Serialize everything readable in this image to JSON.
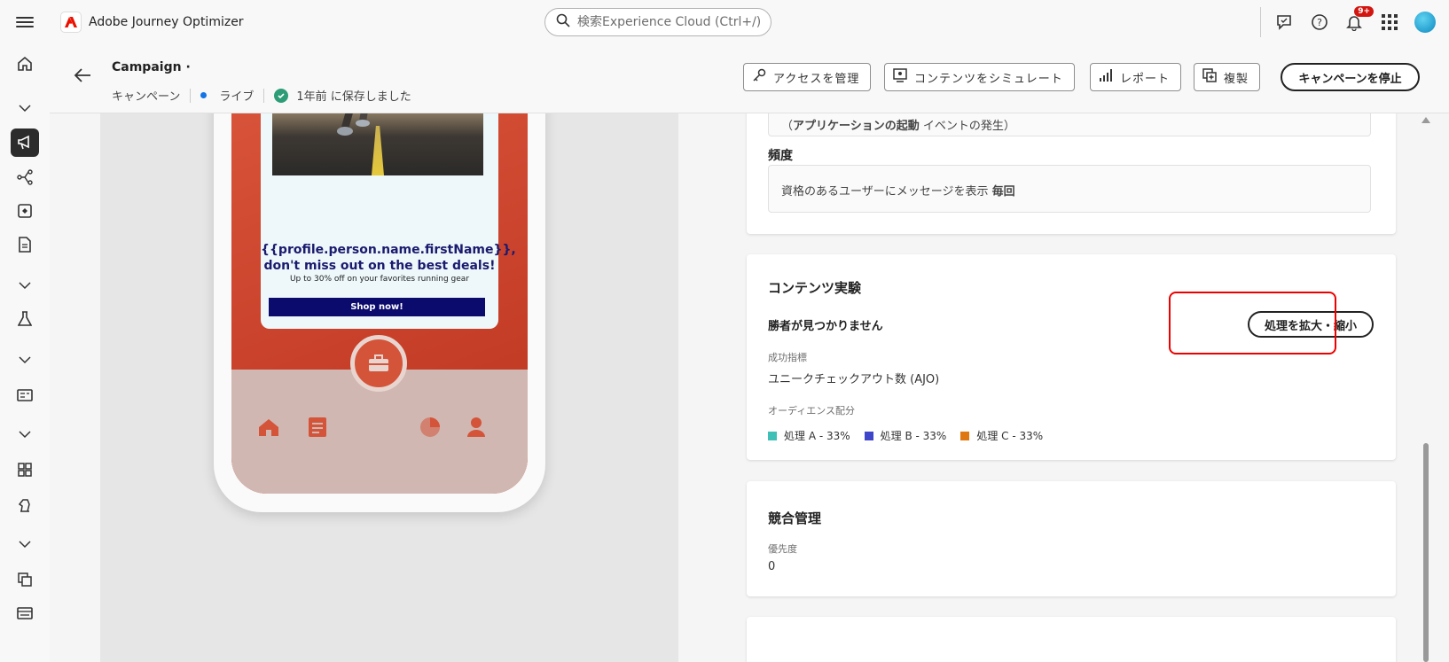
{
  "app": {
    "brand_name": "Adobe Journey Optimizer"
  },
  "search": {
    "placeholder": "検索Experience Cloud (Ctrl+/)"
  },
  "notifications": {
    "badge": "9+"
  },
  "campaign": {
    "title": "Campaign ·",
    "type": "キャンペーン",
    "status": "ライブ",
    "saved": "1年前 に保存しました"
  },
  "toolbar": {
    "manage_access": "アクセスを管理",
    "simulate_content": "コンテンツをシミュレート",
    "report": "レポート",
    "duplicate": "複製",
    "stop_campaign": "キャンペーンを停止"
  },
  "preview": {
    "headline": "{{profile.person.name.firstName}}, don't miss out on the best deals!",
    "subtext": "Up to 30% off on your favorites running gear",
    "cta": "Shop now!"
  },
  "trigger": {
    "text_bold": "アプリケーションの起動",
    "text_rest": "イベントの発生"
  },
  "frequency": {
    "heading": "頻度",
    "text": "資格のあるユーザーにメッセージを表示",
    "text_bold": "毎回"
  },
  "experiment": {
    "heading": "コンテンツ実験",
    "winner": "勝者が見つかりません",
    "expand_button": "処理を拡大・縮小",
    "metric_label": "成功指標",
    "metric_value": "ユニークチェックアウト数 (AJO)",
    "audience_label": "オーディエンス配分",
    "treatments": [
      {
        "label": "処理 A - 33%",
        "color": "#3ec0b6"
      },
      {
        "label": "処理 B - 33%",
        "color": "#4046ca"
      },
      {
        "label": "処理 C - 33%",
        "color": "#e07812"
      }
    ]
  },
  "arbitration": {
    "heading": "競合管理",
    "priority_label": "優先度",
    "priority_value": "0"
  },
  "colors": {
    "accent_blue": "#1473e6",
    "success_green": "#2d9d78",
    "highlight_red": "#e00000"
  }
}
